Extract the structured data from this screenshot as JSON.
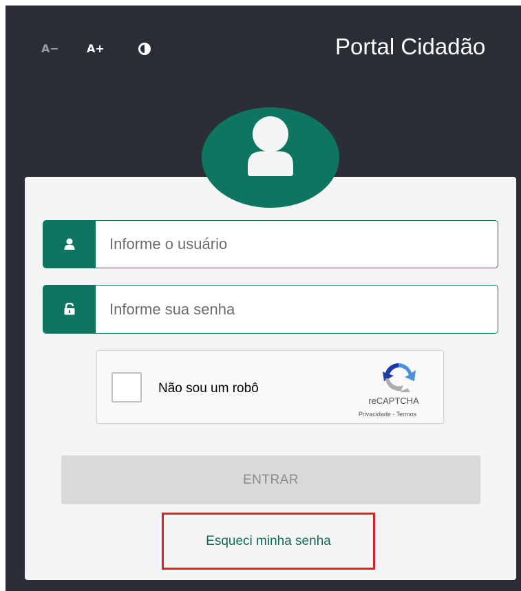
{
  "header": {
    "title": "Portal Cidadão",
    "font_decrease_label": "A−",
    "font_increase_label": "A+",
    "contrast_icon": "contrast-icon"
  },
  "login": {
    "avatar_icon": "user-icon",
    "username": {
      "placeholder": "Informe o usuário",
      "icon": "user-icon"
    },
    "password": {
      "placeholder": "Informe sua senha",
      "icon": "unlock-icon"
    },
    "captcha": {
      "label": "Não sou um robô",
      "brand": "reCAPTCHA",
      "links": "Privacidade - Termos",
      "checked": false
    },
    "submit_label": "ENTRAR",
    "forgot_label": "Esqueci minha senha"
  },
  "colors": {
    "brand_green": "#0e7560",
    "header_bg": "#2b2e37",
    "card_bg": "#f5f5f5",
    "highlight_red": "#e01f26"
  }
}
